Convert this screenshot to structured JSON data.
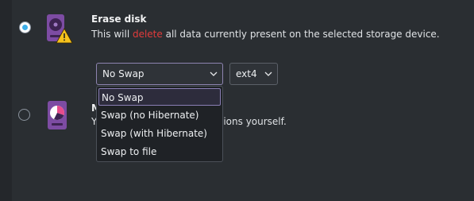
{
  "erase": {
    "title": "Erase disk",
    "desc_before": "This will ",
    "desc_highlight": "delete",
    "desc_after": " all data currently present on the selected storage device.",
    "selected": true,
    "icon": "disk-warning-icon"
  },
  "manual": {
    "title_visible": "M",
    "desc_left": "Y",
    "desc_right": "ions yourself.",
    "selected": false,
    "icon": "disk-pie-icon"
  },
  "swap": {
    "value": "No Swap",
    "options": [
      "No Swap",
      "Swap (no Hibernate)",
      "Swap (with Hibernate)",
      "Swap to file"
    ],
    "selected_index": 0
  },
  "filesystem": {
    "value": "ext4"
  },
  "colors": {
    "background": "#2a2e32",
    "accent": "#3daee9",
    "danger": "#e23b3b",
    "highlight_border": "#8a7fb6",
    "disk_purple": "#7d4ca3"
  }
}
